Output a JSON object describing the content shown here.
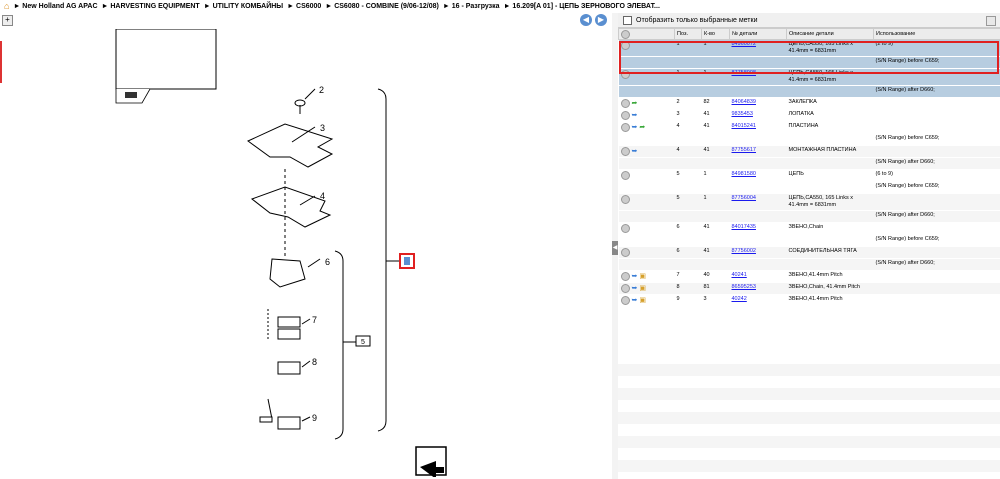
{
  "breadcrumb": {
    "home_icon": "home-icon",
    "items": [
      "New Holland AG APAC",
      "HARVESTING EQUIPMENT",
      "UTILITY КОМБАЙНЫ",
      "CS6000",
      "CS6080 - COMBINE (9/06-12/08)",
      "16 - Разгрузка",
      "16.209[A 01] - ЦЕПЬ ЗЕРНОВОГО ЭЛЕВАТ..."
    ]
  },
  "diagram": {
    "callouts": [
      "2",
      "3",
      "4",
      "6",
      "7",
      "8",
      "9"
    ],
    "group_box_label": "5"
  },
  "filter": {
    "label": "Отобразить только выбранные метки"
  },
  "table": {
    "headers": [
      "Поз.",
      "К-во",
      "№ детали",
      "Описание детали",
      "Использование"
    ],
    "rows": [
      {
        "pos": "1",
        "qty": "1",
        "part": "84960072",
        "desc": "ЦЕПЬ,CA550, 165 Links x 41.4mm = 6831mm",
        "usage": "(2 to 9)",
        "note": "(S/N Range) before C659;",
        "icons": [],
        "style": "sel"
      },
      {
        "pos": "1",
        "qty": "1",
        "part": "87758008",
        "desc": "ЦЕПЬ,CA550, 165 Links x 41.4mm = 6831mm",
        "usage": "",
        "note": "(S/N Range) after D660;",
        "icons": [],
        "style": "sel"
      },
      {
        "pos": "2",
        "qty": "82",
        "part": "84064839",
        "desc": "ЗАКЛЕПКА",
        "usage": "",
        "note": "",
        "icons": [
          "green"
        ],
        "style": "plain"
      },
      {
        "pos": "3",
        "qty": "41",
        "part": "9835453",
        "desc": "ЛОПАТКА",
        "usage": "",
        "note": "",
        "icons": [
          "blue"
        ],
        "style": "plain"
      },
      {
        "pos": "4",
        "qty": "41",
        "part": "84015241",
        "desc": "ПЛАСТИНА",
        "usage": "",
        "note": "(S/N Range) before C659;",
        "icons": [
          "blue",
          "green"
        ],
        "style": "plain"
      },
      {
        "pos": "4",
        "qty": "41",
        "part": "87755617",
        "desc": "МОНТАЖНАЯ ПЛАСТИНА",
        "usage": "",
        "note": "(S/N Range) after D660;",
        "icons": [
          "blue"
        ],
        "style": "alt"
      },
      {
        "pos": "5",
        "qty": "1",
        "part": "84981580",
        "desc": "ЦЕПЬ",
        "usage": "(6 to 9)",
        "note": "(S/N Range) before C659;",
        "icons": [],
        "style": "plain"
      },
      {
        "pos": "5",
        "qty": "1",
        "part": "87756004",
        "desc": "ЦЕПЬ,CA550, 165 Links x 41.4mm = 6831mm",
        "usage": "",
        "note": "(S/N Range) after D660;",
        "icons": [],
        "style": "alt"
      },
      {
        "pos": "6",
        "qty": "41",
        "part": "84017435",
        "desc": "ЗВЕНО,Chain",
        "usage": "",
        "note": "(S/N Range) before C659;",
        "icons": [],
        "style": "plain"
      },
      {
        "pos": "6",
        "qty": "41",
        "part": "87756002",
        "desc": "СОЕДИНИТЕЛЬНАЯ ТЯГА",
        "usage": "",
        "note": "(S/N Range) after D660;",
        "icons": [],
        "style": "alt"
      },
      {
        "pos": "7",
        "qty": "40",
        "part": "40241",
        "desc": "ЗВЕНО,41.4mm Pitch",
        "usage": "",
        "note": "",
        "icons": [
          "blue",
          "box"
        ],
        "style": "plain"
      },
      {
        "pos": "8",
        "qty": "81",
        "part": "86595253",
        "desc": "ЗВЕНО,Chain, 41.4mm Pitch",
        "usage": "",
        "note": "",
        "icons": [
          "blue",
          "box"
        ],
        "style": "alt"
      },
      {
        "pos": "9",
        "qty": "3",
        "part": "40242",
        "desc": "ЗВЕНО,41.4mm Pitch",
        "usage": "",
        "note": "",
        "icons": [
          "blue",
          "box"
        ],
        "style": "plain"
      }
    ]
  },
  "colors": {
    "selected_row": "#b7cde0",
    "highlight_border": "#e02020",
    "link": "#1a1aee"
  }
}
